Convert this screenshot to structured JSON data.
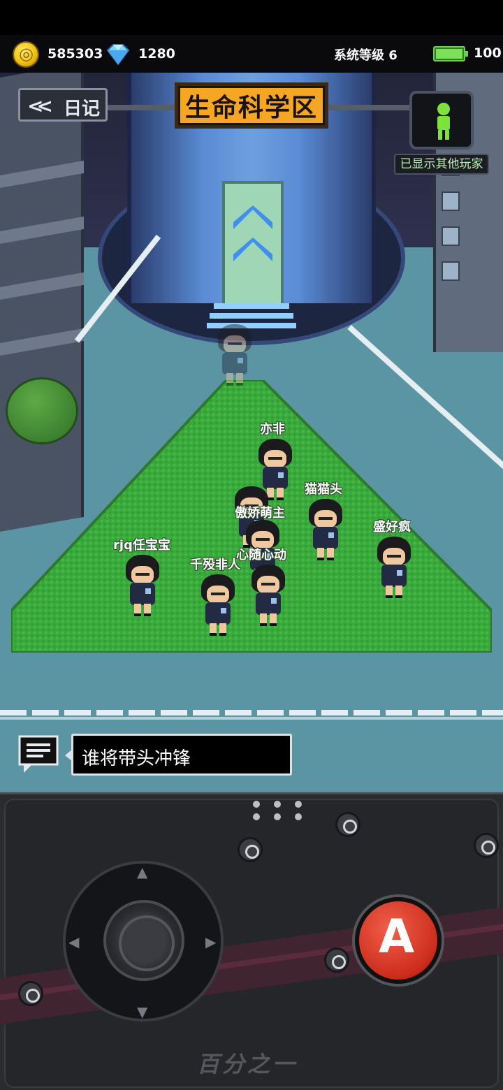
{
  "hud": {
    "coins": "585303",
    "gems": "1280",
    "system_level_label": "系统等级 6",
    "energy": "100",
    "coin_icon": "gold-coin-icon",
    "gem_icon": "diamond-icon",
    "energy_icon": "battery-icon"
  },
  "header": {
    "back_label": "日记",
    "area_title": "生命科学区",
    "toggle_label": "已显示其他玩家"
  },
  "players": [
    {
      "name": "亦非"
    },
    {
      "name": "猫猫头"
    },
    {
      "name": "傲娇萌主"
    },
    {
      "name": "盛好疯"
    },
    {
      "name": "rjq任宝宝"
    },
    {
      "name": "千殁非人"
    },
    {
      "name": "心随心动"
    }
  ],
  "chat": {
    "message": "谁将带头冲锋"
  },
  "controller": {
    "a_button_label": "A",
    "brand": "百分之一"
  },
  "colors": {
    "title_plate": "#f5a623",
    "grass": "#3aa93c",
    "a_button": "#cc2c1c"
  }
}
